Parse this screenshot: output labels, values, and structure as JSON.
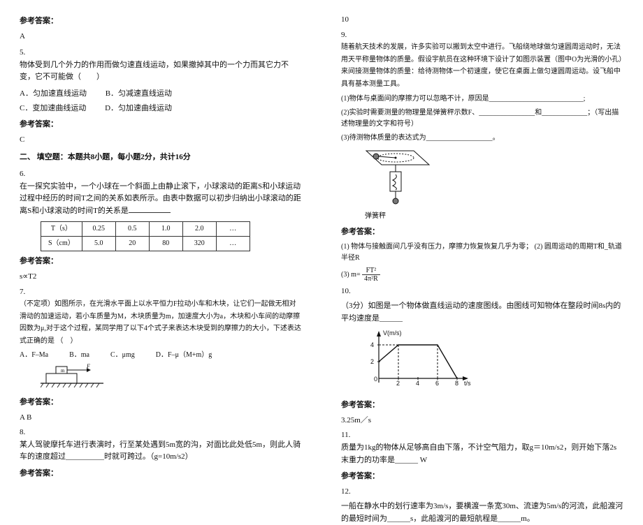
{
  "left": {
    "ans_head": "参考答案：",
    "q4_ans": "A",
    "q5_num": "5.",
    "q5_text": "物体受到几个外力的作用而做匀速直线运动，如果撤掉其中的一个力而其它力不变，它不可能做（　　）",
    "q5_opts": [
      {
        "k": "A．",
        "v": "匀加速直线运动"
      },
      {
        "k": "B．",
        "v": "匀减速直线运动"
      },
      {
        "k": "C．",
        "v": "变加速曲线运动"
      },
      {
        "k": "D．",
        "v": "匀加速曲线运动"
      }
    ],
    "q5_ans": "C",
    "sec2_head": "二、 填空题：本题共8小题，每小题2分，共计16分",
    "q6_num": "6.",
    "q6_text": "在一探究实验中，一个小球在一个斜面上由静止滚下，小球滚动的距离S和小球运动过程中经历的时间T之间的关系如表所示。由表中数据可以初步归纳出小球滚动的距离S和小球滚动的时间T的关系是",
    "table": {
      "r1": [
        "T（s）",
        "0.25",
        "0.5",
        "1.0",
        "2.0",
        "…"
      ],
      "r2": [
        "S（cm）",
        "5.0",
        "20",
        "80",
        "320",
        "…"
      ]
    },
    "q6_ans": "s∝T2",
    "q7_num": "7.",
    "q7_text": "（不定项）如图所示，在光滑水平面上以水平恒力F拉动小车和木块，让它们一起做无相对滑动的加速运动，若小车质量为M，木块质量为m，加速度大小为a，木块和小车间的动摩擦因数为μ,对于这个过程，某同学用了以下4个式子来表达木块受到的摩擦力的大小，下述表达式正确的是 （　）",
    "q7_opts": "A．F–Ma　　　B．ma　　　C．μmg　　　D．F–μ（M+m）g",
    "q7_ans": "AB",
    "q8_num": "8.",
    "q8_text": "某人驾驶摩托车进行表演时，行至某处遇到5m宽的沟，对面比此处低5m，则此人骑车的速度超过__________时就可跨过。（g=10m/s2）"
  },
  "right": {
    "q8_ans": "10",
    "q9_num": "9.",
    "q9_text": "随着航天技术的发展，许多实验可以搬到太空中进行。飞船绕地球做匀速圆周运动时，无法用天平称量物体的质量。假设宇航员在这种环境下设计了如图示装置（图中O为光滑的小孔）来间接测量物体的质量：给待测物体一个初速度，使它在桌面上做匀速圆周运动。设飞船中具有基本测量工具。",
    "q9_1": "(1)物体与桌面间的摩擦力可以忽略不计，原因是___________________________;",
    "q9_2": "(2)实验时需要测量的物理量是弹簧秤示数F、________________和_____________；（写出描述物理量的文字和符号）",
    "q9_3": "(3)待测物体质量的表达式为___________________。",
    "spring_label": "弹簧秤",
    "q9_ans1": "(1) 物体与接触面间几乎没有压力，摩擦力恢复恢复几乎为零；  (2) 圆周运动的周期T和_轨道半径R",
    "q9_ans2_prefix": "(3) m=",
    "frac_num": "FT²",
    "frac_den": "4π²R",
    "q10_num": "10.",
    "q10_text": "（3分）如图是一个物体做直线运动的速度图线。由图线可知物体在整段时间8s内的平均速度是______",
    "chart_data": {
      "type": "line",
      "xlabel": "t/s",
      "ylabel": "V(m/s)",
      "x": [
        0,
        2,
        6,
        8
      ],
      "y": [
        2,
        4,
        4,
        0
      ],
      "xlim": [
        0,
        8
      ],
      "ylim": [
        0,
        5
      ],
      "yticks": [
        2,
        4
      ],
      "xticks": [
        2,
        4,
        6,
        8
      ]
    },
    "q10_ans": "3.25m／s",
    "q11_num": "11.",
    "q11_text": "质量为1kg的物体从足够高自由下落，不计空气阻力，取g＝10m/s2，则开始下落2s末重力的功率是______ W",
    "q12_num": "12.",
    "q12_text": "一船在静水中的划行速率为3m/s，要横渡一条宽30m、流速为5m/s的河流，此船渡河的最短时间为______s，此船渡河的最短航程是______m。",
    "ans_head": "参考答案："
  }
}
